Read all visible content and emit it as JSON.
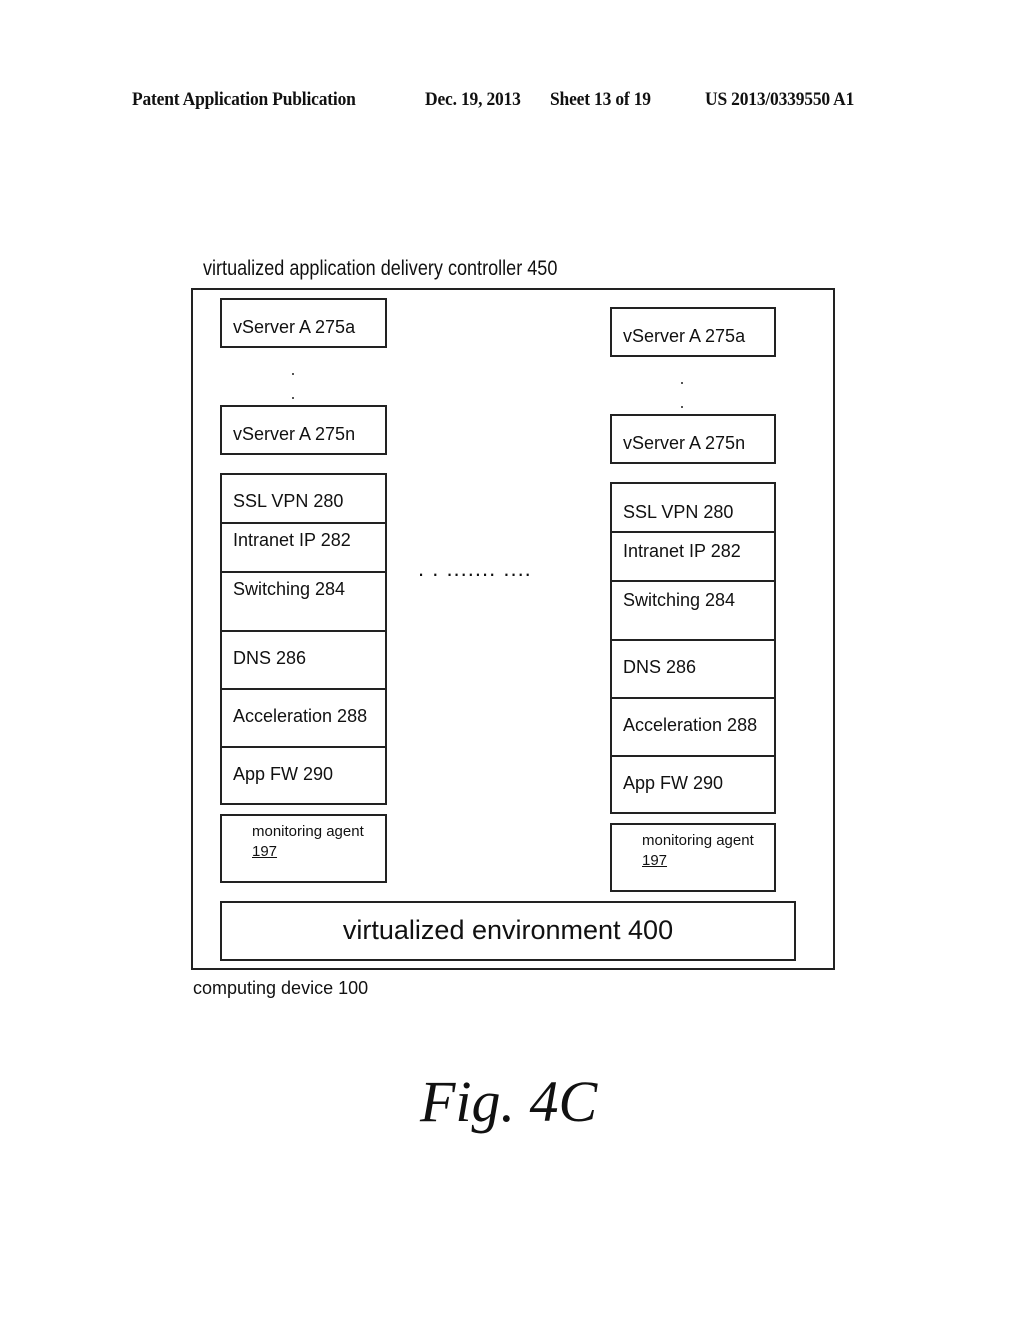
{
  "header": {
    "publication": "Patent Application Publication",
    "date": "Dec. 19, 2013",
    "sheet": "Sheet 13 of 19",
    "patent_number": "US 2013/0339550 A1"
  },
  "diagram": {
    "controller_label": "virtualized application delivery controller 450",
    "device_label": "computing device 100",
    "environment_label": "virtualized environment 400",
    "ellipsis_between_stacks": ". . ....... ....",
    "stacks": [
      {
        "vserver_first": "vServer A 275a",
        "vserver_last": "vServer A 275n",
        "functions": [
          "SSL VPN 280",
          "Intranet IP 282",
          "Switching 284",
          "DNS 286",
          "Acceleration 288",
          "App FW 290"
        ],
        "agent_label": "monitoring agent",
        "agent_ref": "197"
      },
      {
        "vserver_first": "vServer A 275a",
        "vserver_last": "vServer A 275n",
        "functions": [
          "SSL VPN 280",
          "Intranet IP 282",
          "Switching 284",
          "DNS 286",
          "Acceleration 288",
          "App FW 290"
        ],
        "agent_label": "monitoring agent",
        "agent_ref": "197"
      }
    ]
  },
  "figure_caption": "Fig. 4C"
}
